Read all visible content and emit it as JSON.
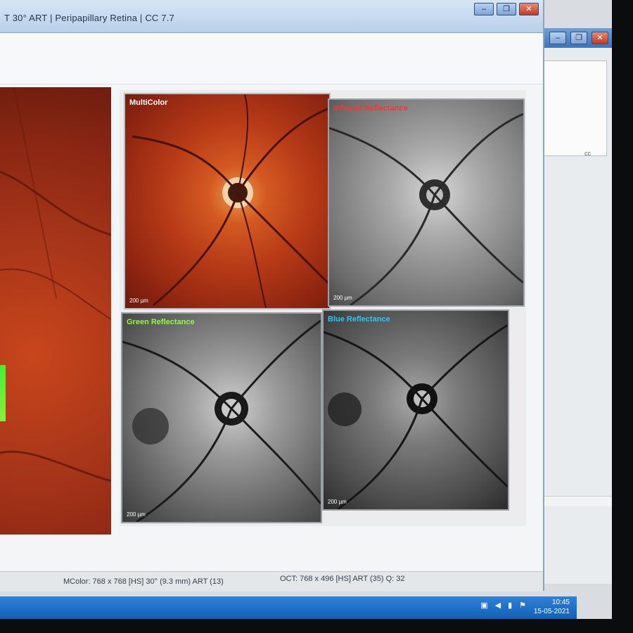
{
  "window": {
    "title": "T 30° ART | Peripapillary Retina | CC 7.7"
  },
  "background_window": {
    "tiny_text": "cc"
  },
  "tiles": [
    {
      "label": "MultiColor",
      "scale": "200 µm",
      "label_color": "#ffffff"
    },
    {
      "label": "Infrared Reflectance",
      "scale": "200 µm",
      "label_color": "#ff3333"
    },
    {
      "label": "Green Reflectance",
      "scale": "200 µm",
      "label_color": "#8bff3a"
    },
    {
      "label": "Blue Reflectance",
      "scale": "200 µm",
      "label_color": "#28c8ff"
    }
  ],
  "status": {
    "left": "MColor: 768 x 768 [HS] 30° (9.3 mm) ART (13)",
    "right": "OCT: 768 x 496 [HS] ART (35) Q: 32"
  },
  "taskbar": {
    "time": "10:45",
    "date": "15-05-2021"
  },
  "colors": {
    "titlebar": "#b8cfe8",
    "taskbar": "#0f5fb4"
  }
}
